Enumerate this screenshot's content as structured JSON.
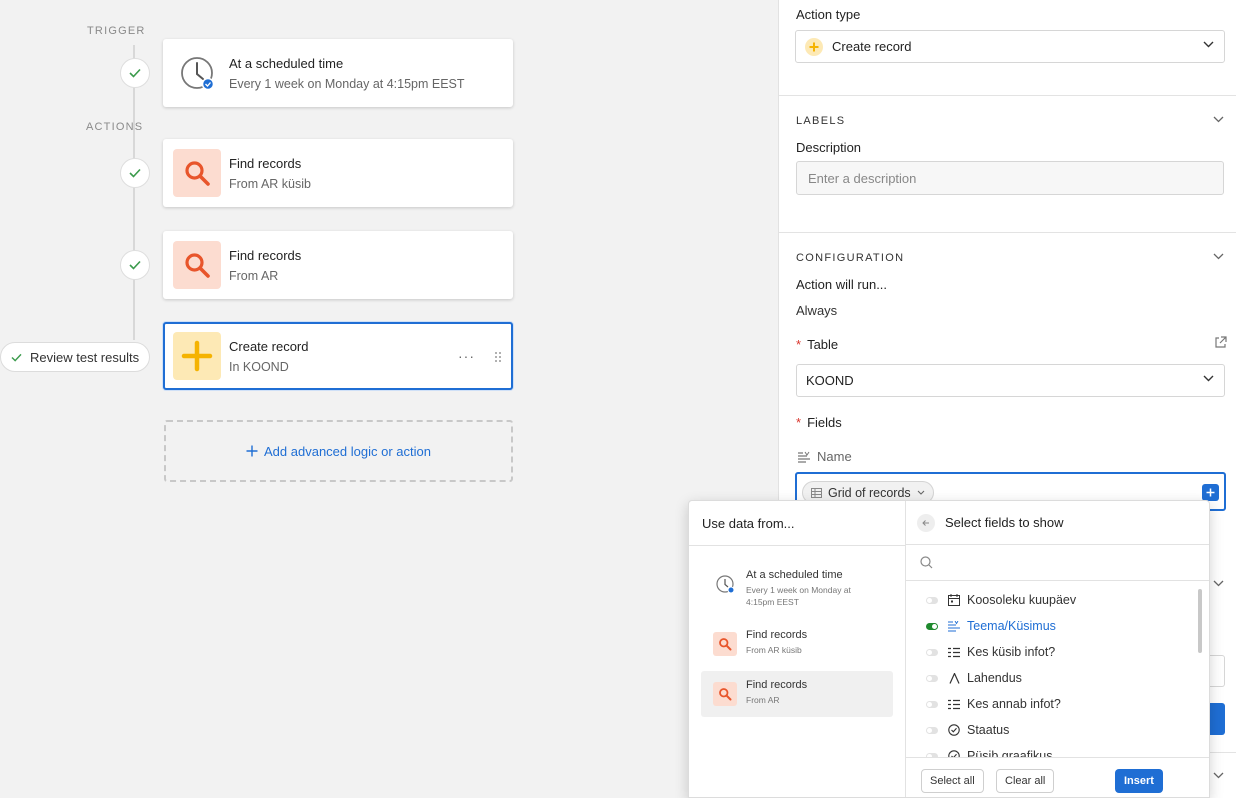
{
  "canvas": {
    "trigger_label": "TRIGGER",
    "actions_label": "ACTIONS",
    "trigger_card": {
      "title": "At a scheduled time",
      "subtitle": "Every 1 week on Monday at 4:15pm EEST"
    },
    "action_cards": [
      {
        "title": "Find records",
        "subtitle": "From AR küsib",
        "icon": "search-icon"
      },
      {
        "title": "Find records",
        "subtitle": "From AR",
        "icon": "search-icon"
      },
      {
        "title": "Create record",
        "subtitle": "In KOOND",
        "icon": "plus-icon",
        "menu": "···"
      }
    ],
    "review_button": "Review test results",
    "add_action": "Add advanced logic or action"
  },
  "panel": {
    "action_type_label": "Action type",
    "action_type_value": "Create record",
    "labels_section": "LABELS",
    "description_label": "Description",
    "description_placeholder": "Enter a description",
    "configuration_section": "CONFIGURATION",
    "run_label": "Action will run...",
    "run_value": "Always",
    "table_label": "Table",
    "table_value": "KOOND",
    "fields_label": "Fields",
    "field_name": "Name",
    "token_label": "Grid of records"
  },
  "popover": {
    "left_title": "Use data from...",
    "sources": [
      {
        "title": "At a scheduled time",
        "subtitle": "Every 1 week on Monday at 4:15pm EEST",
        "icon": "clock-icon"
      },
      {
        "title": "Find records",
        "subtitle": "From AR küsib",
        "icon": "search-icon"
      },
      {
        "title": "Find records",
        "subtitle": "From AR",
        "icon": "search-icon",
        "active": true
      }
    ],
    "right_title": "Select fields to show",
    "fields": [
      {
        "label": "Koosoleku kuupäev",
        "icon": "calendar-icon",
        "on": false
      },
      {
        "label": "Teema/Küsimus",
        "icon": "long-text-icon",
        "on": true
      },
      {
        "label": "Kes küsib infot?",
        "icon": "multi-select-icon",
        "on": false
      },
      {
        "label": "Lahendus",
        "icon": "text-a-icon",
        "on": false
      },
      {
        "label": "Kes annab infot?",
        "icon": "multi-select-icon",
        "on": false
      },
      {
        "label": "Staatus",
        "icon": "status-icon",
        "on": false
      },
      {
        "label": "Püsib graafikus",
        "icon": "status-icon",
        "on": false
      }
    ],
    "select_all": "Select all",
    "clear_all": "Clear all",
    "insert": "Insert"
  },
  "colors": {
    "accent": "#1f6ed4",
    "search_bg": "#fcdcd0",
    "search_fg": "#e8552b",
    "plus_bg": "#fde9b5",
    "plus_fg": "#f5b301",
    "toggle_on": "#1f8a2e"
  }
}
